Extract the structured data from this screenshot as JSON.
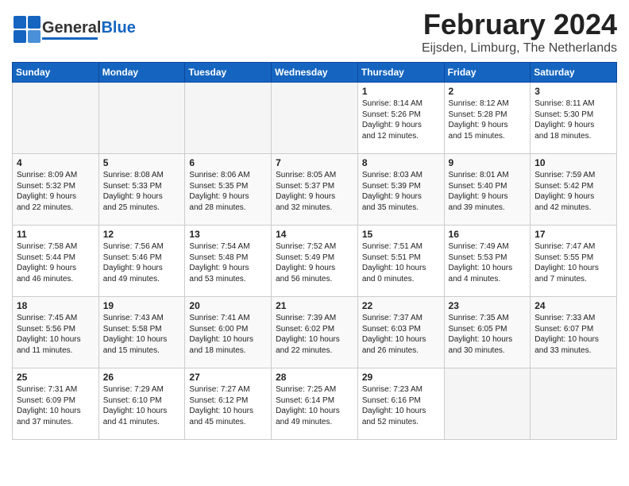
{
  "header": {
    "logo_general": "General",
    "logo_blue": "Blue",
    "month": "February 2024",
    "location": "Eijsden, Limburg, The Netherlands"
  },
  "days_of_week": [
    "Sunday",
    "Monday",
    "Tuesday",
    "Wednesday",
    "Thursday",
    "Friday",
    "Saturday"
  ],
  "weeks": [
    [
      {
        "day": "",
        "info": ""
      },
      {
        "day": "",
        "info": ""
      },
      {
        "day": "",
        "info": ""
      },
      {
        "day": "",
        "info": ""
      },
      {
        "day": "1",
        "info": "Sunrise: 8:14 AM\nSunset: 5:26 PM\nDaylight: 9 hours\nand 12 minutes."
      },
      {
        "day": "2",
        "info": "Sunrise: 8:12 AM\nSunset: 5:28 PM\nDaylight: 9 hours\nand 15 minutes."
      },
      {
        "day": "3",
        "info": "Sunrise: 8:11 AM\nSunset: 5:30 PM\nDaylight: 9 hours\nand 18 minutes."
      }
    ],
    [
      {
        "day": "4",
        "info": "Sunrise: 8:09 AM\nSunset: 5:32 PM\nDaylight: 9 hours\nand 22 minutes."
      },
      {
        "day": "5",
        "info": "Sunrise: 8:08 AM\nSunset: 5:33 PM\nDaylight: 9 hours\nand 25 minutes."
      },
      {
        "day": "6",
        "info": "Sunrise: 8:06 AM\nSunset: 5:35 PM\nDaylight: 9 hours\nand 28 minutes."
      },
      {
        "day": "7",
        "info": "Sunrise: 8:05 AM\nSunset: 5:37 PM\nDaylight: 9 hours\nand 32 minutes."
      },
      {
        "day": "8",
        "info": "Sunrise: 8:03 AM\nSunset: 5:39 PM\nDaylight: 9 hours\nand 35 minutes."
      },
      {
        "day": "9",
        "info": "Sunrise: 8:01 AM\nSunset: 5:40 PM\nDaylight: 9 hours\nand 39 minutes."
      },
      {
        "day": "10",
        "info": "Sunrise: 7:59 AM\nSunset: 5:42 PM\nDaylight: 9 hours\nand 42 minutes."
      }
    ],
    [
      {
        "day": "11",
        "info": "Sunrise: 7:58 AM\nSunset: 5:44 PM\nDaylight: 9 hours\nand 46 minutes."
      },
      {
        "day": "12",
        "info": "Sunrise: 7:56 AM\nSunset: 5:46 PM\nDaylight: 9 hours\nand 49 minutes."
      },
      {
        "day": "13",
        "info": "Sunrise: 7:54 AM\nSunset: 5:48 PM\nDaylight: 9 hours\nand 53 minutes."
      },
      {
        "day": "14",
        "info": "Sunrise: 7:52 AM\nSunset: 5:49 PM\nDaylight: 9 hours\nand 56 minutes."
      },
      {
        "day": "15",
        "info": "Sunrise: 7:51 AM\nSunset: 5:51 PM\nDaylight: 10 hours\nand 0 minutes."
      },
      {
        "day": "16",
        "info": "Sunrise: 7:49 AM\nSunset: 5:53 PM\nDaylight: 10 hours\nand 4 minutes."
      },
      {
        "day": "17",
        "info": "Sunrise: 7:47 AM\nSunset: 5:55 PM\nDaylight: 10 hours\nand 7 minutes."
      }
    ],
    [
      {
        "day": "18",
        "info": "Sunrise: 7:45 AM\nSunset: 5:56 PM\nDaylight: 10 hours\nand 11 minutes."
      },
      {
        "day": "19",
        "info": "Sunrise: 7:43 AM\nSunset: 5:58 PM\nDaylight: 10 hours\nand 15 minutes."
      },
      {
        "day": "20",
        "info": "Sunrise: 7:41 AM\nSunset: 6:00 PM\nDaylight: 10 hours\nand 18 minutes."
      },
      {
        "day": "21",
        "info": "Sunrise: 7:39 AM\nSunset: 6:02 PM\nDaylight: 10 hours\nand 22 minutes."
      },
      {
        "day": "22",
        "info": "Sunrise: 7:37 AM\nSunset: 6:03 PM\nDaylight: 10 hours\nand 26 minutes."
      },
      {
        "day": "23",
        "info": "Sunrise: 7:35 AM\nSunset: 6:05 PM\nDaylight: 10 hours\nand 30 minutes."
      },
      {
        "day": "24",
        "info": "Sunrise: 7:33 AM\nSunset: 6:07 PM\nDaylight: 10 hours\nand 33 minutes."
      }
    ],
    [
      {
        "day": "25",
        "info": "Sunrise: 7:31 AM\nSunset: 6:09 PM\nDaylight: 10 hours\nand 37 minutes."
      },
      {
        "day": "26",
        "info": "Sunrise: 7:29 AM\nSunset: 6:10 PM\nDaylight: 10 hours\nand 41 minutes."
      },
      {
        "day": "27",
        "info": "Sunrise: 7:27 AM\nSunset: 6:12 PM\nDaylight: 10 hours\nand 45 minutes."
      },
      {
        "day": "28",
        "info": "Sunrise: 7:25 AM\nSunset: 6:14 PM\nDaylight: 10 hours\nand 49 minutes."
      },
      {
        "day": "29",
        "info": "Sunrise: 7:23 AM\nSunset: 6:16 PM\nDaylight: 10 hours\nand 52 minutes."
      },
      {
        "day": "",
        "info": ""
      },
      {
        "day": "",
        "info": ""
      }
    ]
  ]
}
